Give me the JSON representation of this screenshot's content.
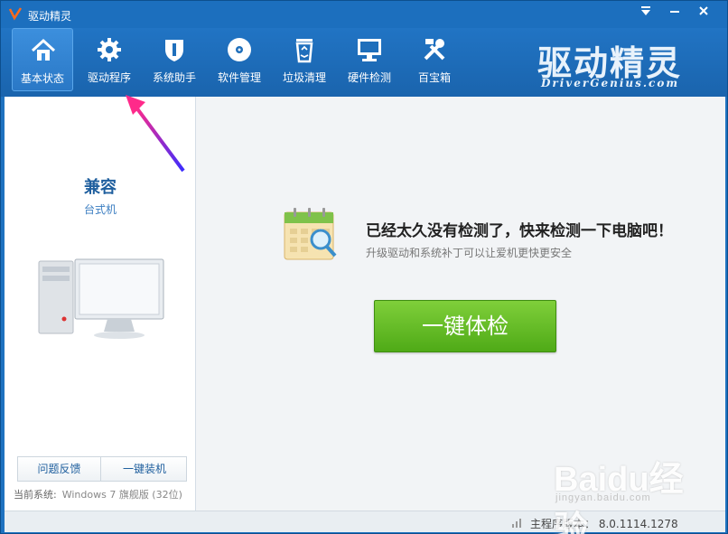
{
  "window": {
    "title": "驱动精灵"
  },
  "titlebar": {
    "menu_icon": "dropdown-icon",
    "min_icon": "minimize-icon",
    "close_icon": "close-icon"
  },
  "nav": [
    {
      "label": "基本状态",
      "icon": "home-icon",
      "active": true
    },
    {
      "label": "驱动程序",
      "icon": "gear-icon",
      "active": false
    },
    {
      "label": "系统助手",
      "icon": "shield-icon",
      "active": false
    },
    {
      "label": "软件管理",
      "icon": "disc-icon",
      "active": false
    },
    {
      "label": "垃圾清理",
      "icon": "recycle-bin-icon",
      "active": false
    },
    {
      "label": "硬件检测",
      "icon": "monitor-icon",
      "active": false
    },
    {
      "label": "百宝箱",
      "icon": "tools-icon",
      "active": false
    }
  ],
  "brand": {
    "name": "驱动精灵",
    "domain": "DriverGenius.com"
  },
  "sidebar": {
    "compat": "兼容",
    "pc_type": "台式机",
    "feedback_label": "问题反馈",
    "install_label": "一键装机",
    "system_label": "当前系统:",
    "system_value": "Windows 7 旗舰版 (32位)"
  },
  "main": {
    "headline": "已经太久没有检测了，快来检测一下电脑吧！",
    "subline": "升级驱动和系统补丁可以让爱机更快更安全",
    "check_button": "一键体检"
  },
  "status": {
    "version": "主程序版本： 8.0.1114.1278"
  },
  "watermark": {
    "brand": "Bai",
    "brand2": "经验",
    "url": "jingyan.baidu.com"
  },
  "colors": {
    "accent": "#1f72c0",
    "button_green": "#5fb824",
    "link": "#1f5f9e"
  }
}
